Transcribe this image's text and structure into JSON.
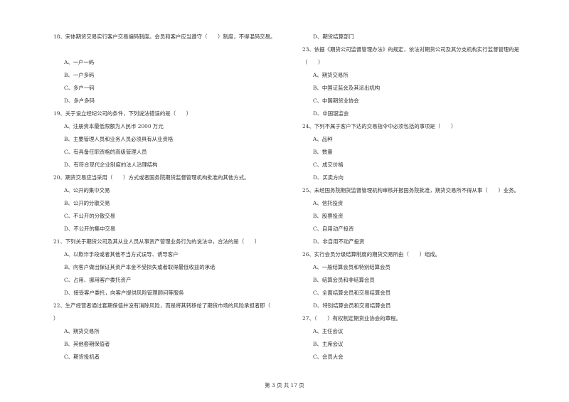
{
  "left_column": [
    {
      "type": "question",
      "text": "18、宋体期货交易实行客户交易编码制度。会员和客户应当遵守（　　）制度，不得混码交易。"
    },
    {
      "type": "blank",
      "text": ""
    },
    {
      "type": "option",
      "text": "A、一户一码"
    },
    {
      "type": "option",
      "text": "B、一户多码"
    },
    {
      "type": "option",
      "text": "C、多户一码"
    },
    {
      "type": "option",
      "text": "D、多户多码"
    },
    {
      "type": "question",
      "text": "19、关于设立经纪公司的条件，下列说法错误的是（　　）"
    },
    {
      "type": "option",
      "text": "A、注册资本最低限额为人民币 2000 万元"
    },
    {
      "type": "option",
      "text": "B、主要管理人员和业务人员必须具有从业资格"
    },
    {
      "type": "option",
      "text": "C、有具备任职资格的高级管理人员"
    },
    {
      "type": "option",
      "text": "D、有符合现代企业制度的法人治理结构"
    },
    {
      "type": "question",
      "text": "20、期货交易应当采用（　　）方式或者国务院期货监督管理机构批准的其他方式。"
    },
    {
      "type": "option",
      "text": "A、公开的集中交易"
    },
    {
      "type": "option",
      "text": "B、公开的分散交易"
    },
    {
      "type": "option",
      "text": "C、不公开的分散交易"
    },
    {
      "type": "option",
      "text": "D、不公开的集中交易"
    },
    {
      "type": "question",
      "text": "21、下列关于期货公司及其从业人员从事资产管理业务行为的说法中，合法的是（　　）"
    },
    {
      "type": "option",
      "text": "A、以欺诈手段或者其他不当方式误导、诱导客户"
    },
    {
      "type": "option",
      "text": "B、向客户做出保证其资产本金不受损失或者取得最低收益的承诺"
    },
    {
      "type": "option",
      "text": "C、占用、挪用客户委托资产"
    },
    {
      "type": "option",
      "text": "D、接受客户委托，向客户提供风险管理顾问等服务"
    },
    {
      "type": "question",
      "text": "22、生产经营者通过套期保值并没有消除风险，而是将其转移给了期货市场的风险承担者即（"
    },
    {
      "type": "continuation",
      "text": "）"
    },
    {
      "type": "option",
      "text": "A、期货交易所"
    },
    {
      "type": "option",
      "text": "B、其他套期保值者"
    },
    {
      "type": "option",
      "text": "C、期货投机者"
    }
  ],
  "right_column": [
    {
      "type": "option",
      "text": "D、期货结算部门"
    },
    {
      "type": "question",
      "text": "23、依据《期货公司监督管理办法》的规定，依法对期货公司及其分支机构实行监督管理的是"
    },
    {
      "type": "continuation",
      "text": "（　　）"
    },
    {
      "type": "option",
      "text": "A、期货交易所"
    },
    {
      "type": "option",
      "text": "B、中国证监会及其派出机构"
    },
    {
      "type": "option",
      "text": "C、中国期货业协会"
    },
    {
      "type": "option",
      "text": "D、中国银监会"
    },
    {
      "type": "question",
      "text": "24、下列不属于客户下达的交易指令中必须包括的事项是（　　）"
    },
    {
      "type": "option",
      "text": "A、品种"
    },
    {
      "type": "option",
      "text": "B、数量"
    },
    {
      "type": "option",
      "text": "C、成交价格"
    },
    {
      "type": "option",
      "text": "D、买卖方向"
    },
    {
      "type": "question",
      "text": "25、未经国务院期货监督管理机构审核并报国务院批准，期货交易所不得从事（　　）业务。"
    },
    {
      "type": "option",
      "text": "A、信托投资"
    },
    {
      "type": "option",
      "text": "B、股票投资"
    },
    {
      "type": "option",
      "text": "C、自用动产投资"
    },
    {
      "type": "option",
      "text": "D、非自用不动产投资"
    },
    {
      "type": "question",
      "text": "26、实行会员分级结算制度的期货交易所由（　　）组成。"
    },
    {
      "type": "option",
      "text": "A、一般结算会员和特别结算会员"
    },
    {
      "type": "option",
      "text": "B、结算会员和非结算会员"
    },
    {
      "type": "option",
      "text": "C、全面结算会员和交易结算会员"
    },
    {
      "type": "option",
      "text": "D、特别结算会员和交易结算会员"
    },
    {
      "type": "question",
      "text": "27、（　　）有权制定期货业协会的章程。"
    },
    {
      "type": "option",
      "text": "A、主任会议"
    },
    {
      "type": "option",
      "text": "B、主席会议"
    },
    {
      "type": "option",
      "text": "C、会员大会"
    }
  ],
  "footer": {
    "page_label": "第 3 页 共 17 页"
  }
}
